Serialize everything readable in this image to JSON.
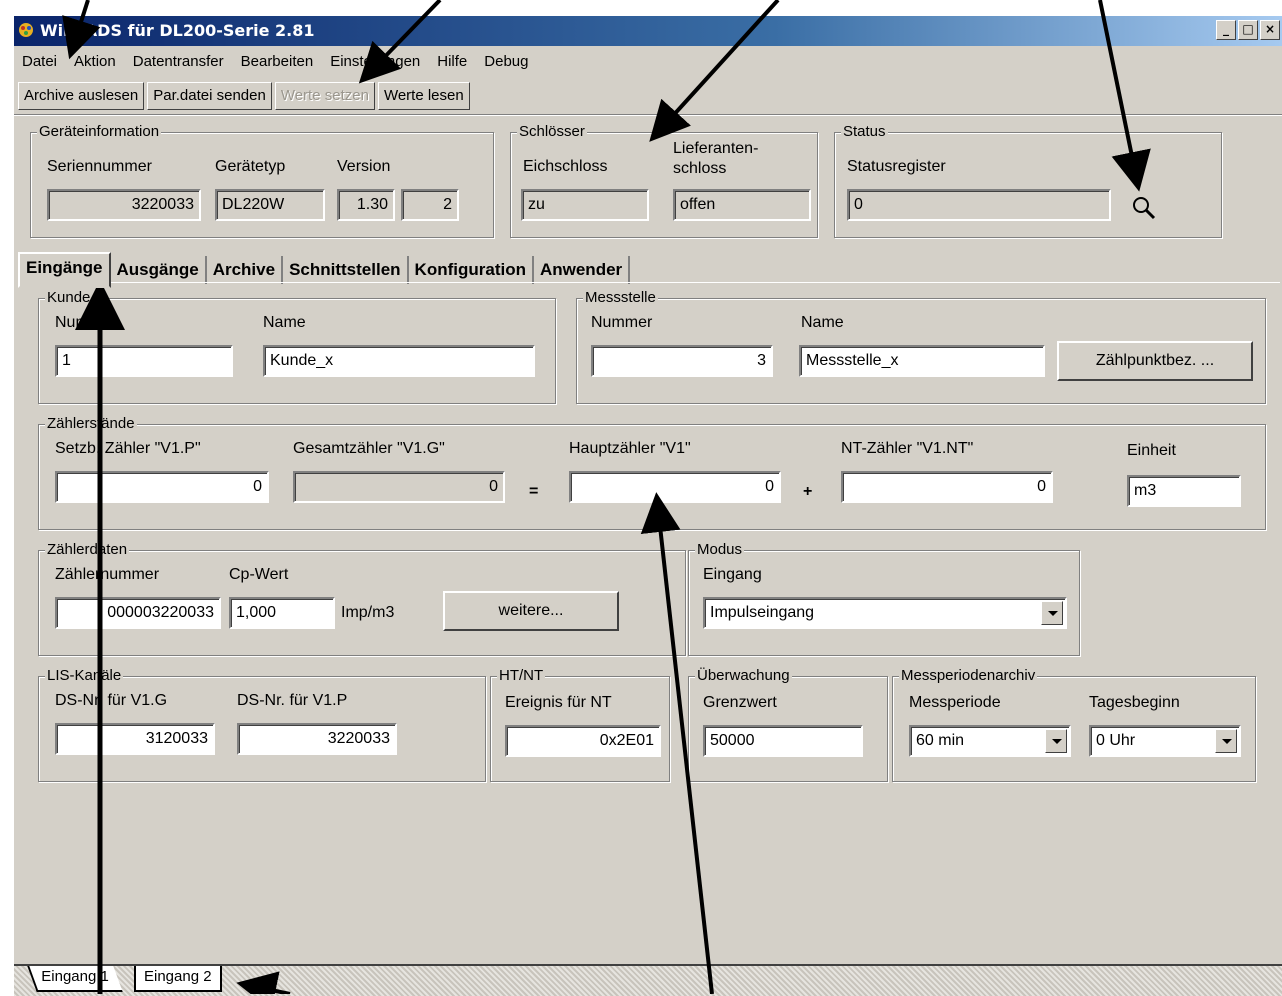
{
  "window": {
    "title": "WinPADS für DL200-Serie 2.81",
    "controls": [
      "_",
      "□",
      "×"
    ]
  },
  "menu": [
    "Datei",
    "Aktion",
    "Datentransfer",
    "Bearbeiten",
    "Einstellungen",
    "Hilfe",
    "Debug"
  ],
  "toolbar": {
    "archive": "Archive auslesen",
    "par_send": "Par.datei senden",
    "set_values": "Werte setzen",
    "read_values": "Werte lesen"
  },
  "geraeteinfo": {
    "title": "Geräteinformation",
    "serial_label": "Seriennummer",
    "serial": "3220033",
    "type_label": "Gerätetyp",
    "type": "DL220W",
    "version_label": "Version",
    "version": "1.30",
    "version2": "2"
  },
  "schloesser": {
    "title": "Schlösser",
    "eich_label": "Eichschloss",
    "eich": "zu",
    "lief_label1": "Lieferanten-",
    "lief_label2": "schloss",
    "lief": "offen"
  },
  "status": {
    "title": "Status",
    "reg_label": "Statusregister",
    "reg": "0",
    "icon": "magnifier-icon"
  },
  "tabs": [
    "Eingänge",
    "Ausgänge",
    "Archive",
    "Schnittstellen",
    "Konfiguration",
    "Anwender"
  ],
  "kunde": {
    "title": "Kunde",
    "nummer_label": "Nummer",
    "nummer": "1",
    "name_label": "Name",
    "name": "Kunde_x"
  },
  "messstelle": {
    "title": "Messstelle",
    "nummer_label": "Nummer",
    "nummer": "3",
    "name_label": "Name",
    "name": "Messstelle_x",
    "button": "Zählpunktbez. ..."
  },
  "zaehlerstaende": {
    "title": "Zählerstände",
    "setz_label": "Setzb. Zähler \"V1.P\"",
    "setz": "0",
    "gesamt_label": "Gesamtzähler \"V1.G\"",
    "gesamt": "0",
    "eq": "=",
    "haupt_label": "Hauptzähler \"V1\"",
    "haupt": "0",
    "plus": "+",
    "nt_label": "NT-Zähler \"V1.NT\"",
    "nt": "0",
    "einheit_label": "Einheit",
    "einheit": "m3"
  },
  "zaehlerdaten": {
    "title": "Zählerdaten",
    "nr_label": "Zählernummer",
    "nr": "000003220033",
    "cp_label": "Cp-Wert",
    "cp": "1,000",
    "unit": "Imp/m3",
    "more": "weitere..."
  },
  "modus": {
    "title": "Modus",
    "eingang_label": "Eingang",
    "eingang": "Impulseingang"
  },
  "lis": {
    "title": "LIS-Kanäle",
    "g_label": "DS-Nr. für V1.G",
    "g": "3120033",
    "p_label": "DS-Nr. für V1.P",
    "p": "3220033"
  },
  "htnt": {
    "title": "HT/NT",
    "label": "Ereignis für NT",
    "value": "0x2E01"
  },
  "ueberwachung": {
    "title": "Überwachung",
    "label": "Grenzwert",
    "value": "50000"
  },
  "messperiode": {
    "title": "Messperiodenarchiv",
    "periode_label": "Messperiode",
    "periode": "60 min",
    "tag_label": "Tagesbeginn",
    "tag": "0 Uhr"
  },
  "bottom_tabs": [
    "Eingang 1",
    "Eingang 2"
  ]
}
